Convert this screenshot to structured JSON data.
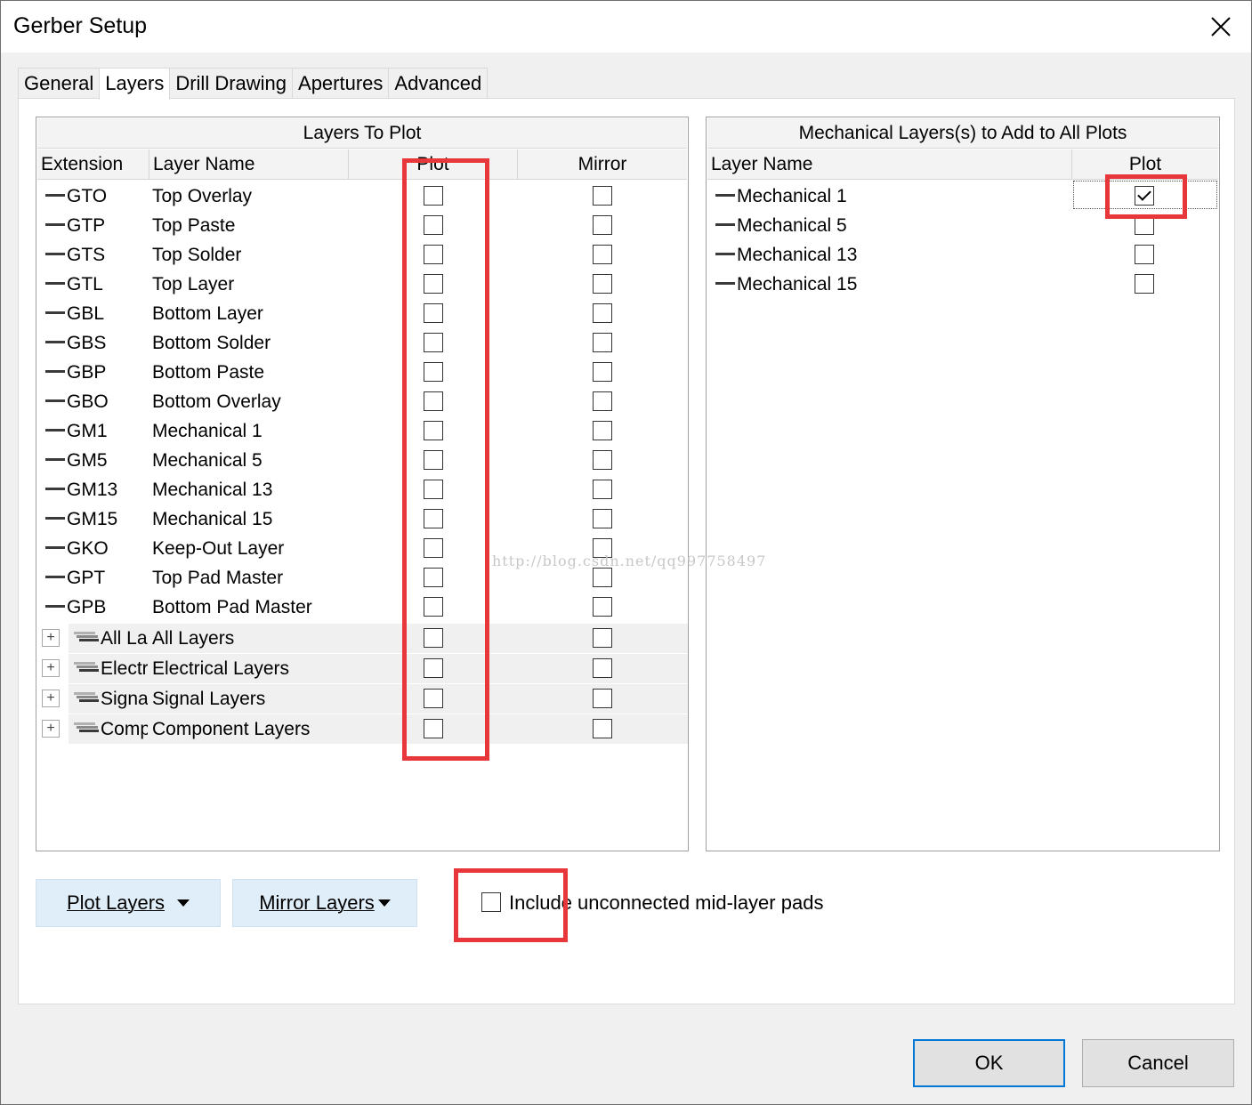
{
  "window": {
    "title": "Gerber Setup"
  },
  "tabs": [
    {
      "label": "General",
      "active": false
    },
    {
      "label": "Layers",
      "active": true
    },
    {
      "label": "Drill Drawing",
      "active": false
    },
    {
      "label": "Apertures",
      "active": false
    },
    {
      "label": "Advanced",
      "active": false
    }
  ],
  "layers_to_plot": {
    "title": "Layers To Plot",
    "columns": {
      "extension": "Extension",
      "layer_name": "Layer Name",
      "plot": "Plot",
      "mirror": "Mirror"
    },
    "rows": [
      {
        "ext": "GTO",
        "name": "Top Overlay",
        "plot": false,
        "mirror": false
      },
      {
        "ext": "GTP",
        "name": "Top Paste",
        "plot": false,
        "mirror": false
      },
      {
        "ext": "GTS",
        "name": "Top Solder",
        "plot": false,
        "mirror": false
      },
      {
        "ext": "GTL",
        "name": "Top Layer",
        "plot": false,
        "mirror": false
      },
      {
        "ext": "GBL",
        "name": "Bottom Layer",
        "plot": false,
        "mirror": false
      },
      {
        "ext": "GBS",
        "name": "Bottom Solder",
        "plot": false,
        "mirror": false
      },
      {
        "ext": "GBP",
        "name": "Bottom Paste",
        "plot": false,
        "mirror": false
      },
      {
        "ext": "GBO",
        "name": "Bottom Overlay",
        "plot": false,
        "mirror": false
      },
      {
        "ext": "GM1",
        "name": "Mechanical 1",
        "plot": false,
        "mirror": false
      },
      {
        "ext": "GM5",
        "name": "Mechanical 5",
        "plot": false,
        "mirror": false
      },
      {
        "ext": "GM13",
        "name": "Mechanical 13",
        "plot": false,
        "mirror": false
      },
      {
        "ext": "GM15",
        "name": "Mechanical 15",
        "plot": false,
        "mirror": false
      },
      {
        "ext": "GKO",
        "name": "Keep-Out Layer",
        "plot": false,
        "mirror": false
      },
      {
        "ext": "GPT",
        "name": "Top Pad Master",
        "plot": false,
        "mirror": false
      },
      {
        "ext": "GPB",
        "name": "Bottom Pad Master",
        "plot": false,
        "mirror": false
      }
    ],
    "groups": [
      {
        "ext": "All La",
        "name": "All Layers",
        "expander": "+",
        "plot": false,
        "mirror": false
      },
      {
        "ext": "Electr",
        "name": "Electrical Layers",
        "expander": "+",
        "plot": false,
        "mirror": false
      },
      {
        "ext": "Signa",
        "name": "Signal Layers",
        "expander": "+",
        "plot": false,
        "mirror": false
      },
      {
        "ext": "Comp",
        "name": "Component Layers",
        "expander": "+",
        "plot": false,
        "mirror": false
      }
    ]
  },
  "mechanical_layers": {
    "title": "Mechanical Layers(s) to Add to All Plots",
    "columns": {
      "layer_name": "Layer Name",
      "plot": "Plot"
    },
    "rows": [
      {
        "name": "Mechanical 1",
        "plot": true
      },
      {
        "name": "Mechanical 5",
        "plot": false
      },
      {
        "name": "Mechanical 13",
        "plot": false
      },
      {
        "name": "Mechanical 15",
        "plot": false
      }
    ]
  },
  "buttons": {
    "plot_layers": "Plot Layers",
    "mirror_layers": "Mirror Layers",
    "ok": "OK",
    "cancel": "Cancel"
  },
  "include_unconnected": {
    "label": "Include unconnected mid-layer pads",
    "checked": false
  },
  "watermark": "http://blog.csdn.net/qq997758497",
  "colors": {
    "highlight_red": "#e8373b",
    "button_blue": "#e0eefa",
    "default_border": "#0078d7"
  }
}
